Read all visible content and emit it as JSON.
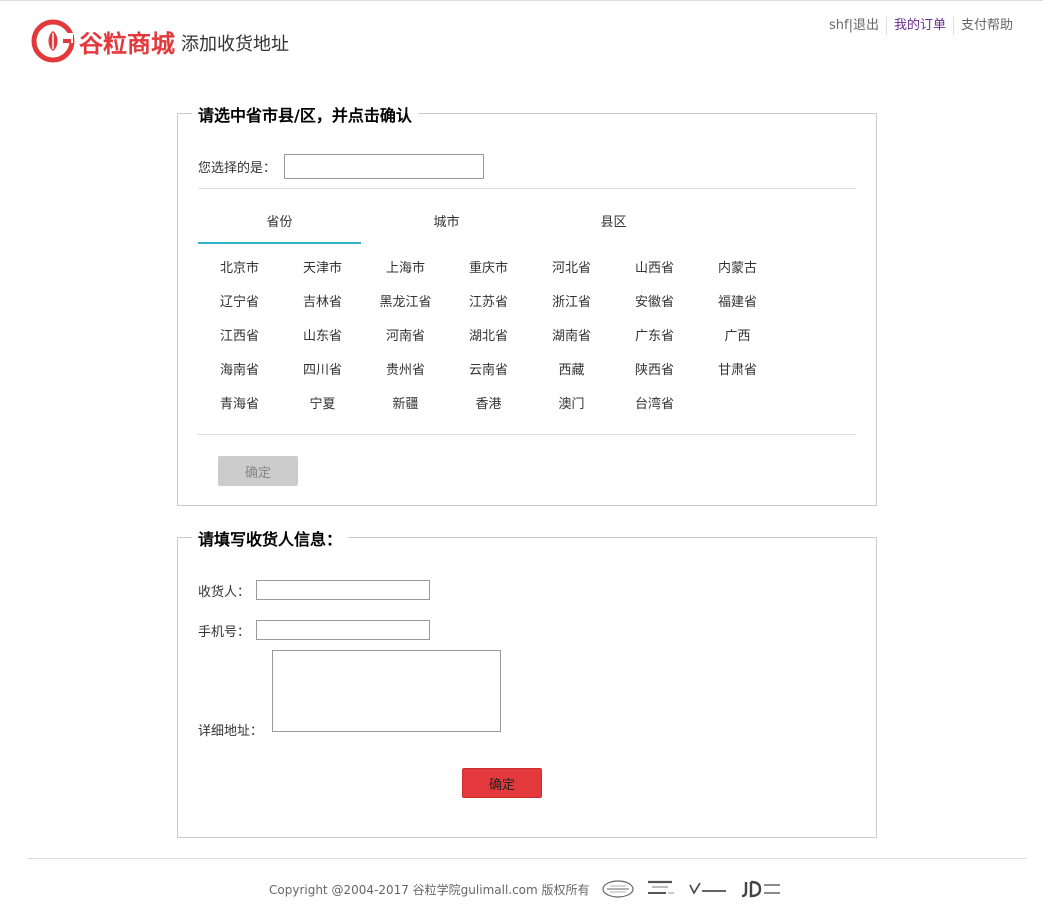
{
  "header": {
    "logo_text": "谷粒商城",
    "page_title": "添加收货地址",
    "nav": {
      "logout": "shf|退出",
      "orders": "我的订单",
      "help": "支付帮助"
    }
  },
  "area_section": {
    "legend": "请选中省市县/区，并点击确认",
    "picked_label": "您选择的是：",
    "picked_value": "",
    "tabs": [
      "省份",
      "城市",
      "县区"
    ],
    "provinces": [
      "北京市",
      "天津市",
      "上海市",
      "重庆市",
      "河北省",
      "山西省",
      "内蒙古",
      "辽宁省",
      "吉林省",
      "黑龙江省",
      "江苏省",
      "浙江省",
      "安徽省",
      "福建省",
      "江西省",
      "山东省",
      "河南省",
      "湖北省",
      "湖南省",
      "广东省",
      "广西",
      "海南省",
      "四川省",
      "贵州省",
      "云南省",
      "西藏",
      "陕西省",
      "甘肃省",
      "青海省",
      "宁夏",
      "新疆",
      "香港",
      "澳门",
      "台湾省"
    ],
    "confirm_label": "确定"
  },
  "info_section": {
    "legend": "请填写收货人信息：",
    "receiver_label": "收货人：",
    "receiver_value": "",
    "phone_label": "手机号：",
    "phone_value": "",
    "address_label": "详细地址：",
    "address_value": "",
    "confirm_label": "确定"
  },
  "footer": {
    "copyright": "Copyright @2004-2017 谷粒学院gulimall.com 版权所有",
    "badges": [
      {
        "icon": "ccg-badge-icon"
      },
      {
        "icon": "verified-by-visa-icon"
      },
      {
        "icon": "verisign-icon"
      },
      {
        "icon": "jd-com-icon"
      }
    ]
  },
  "colors": {
    "brand": "#e4393c",
    "tab_active": "#31b0c6",
    "orders_link": "#6a2c91"
  }
}
